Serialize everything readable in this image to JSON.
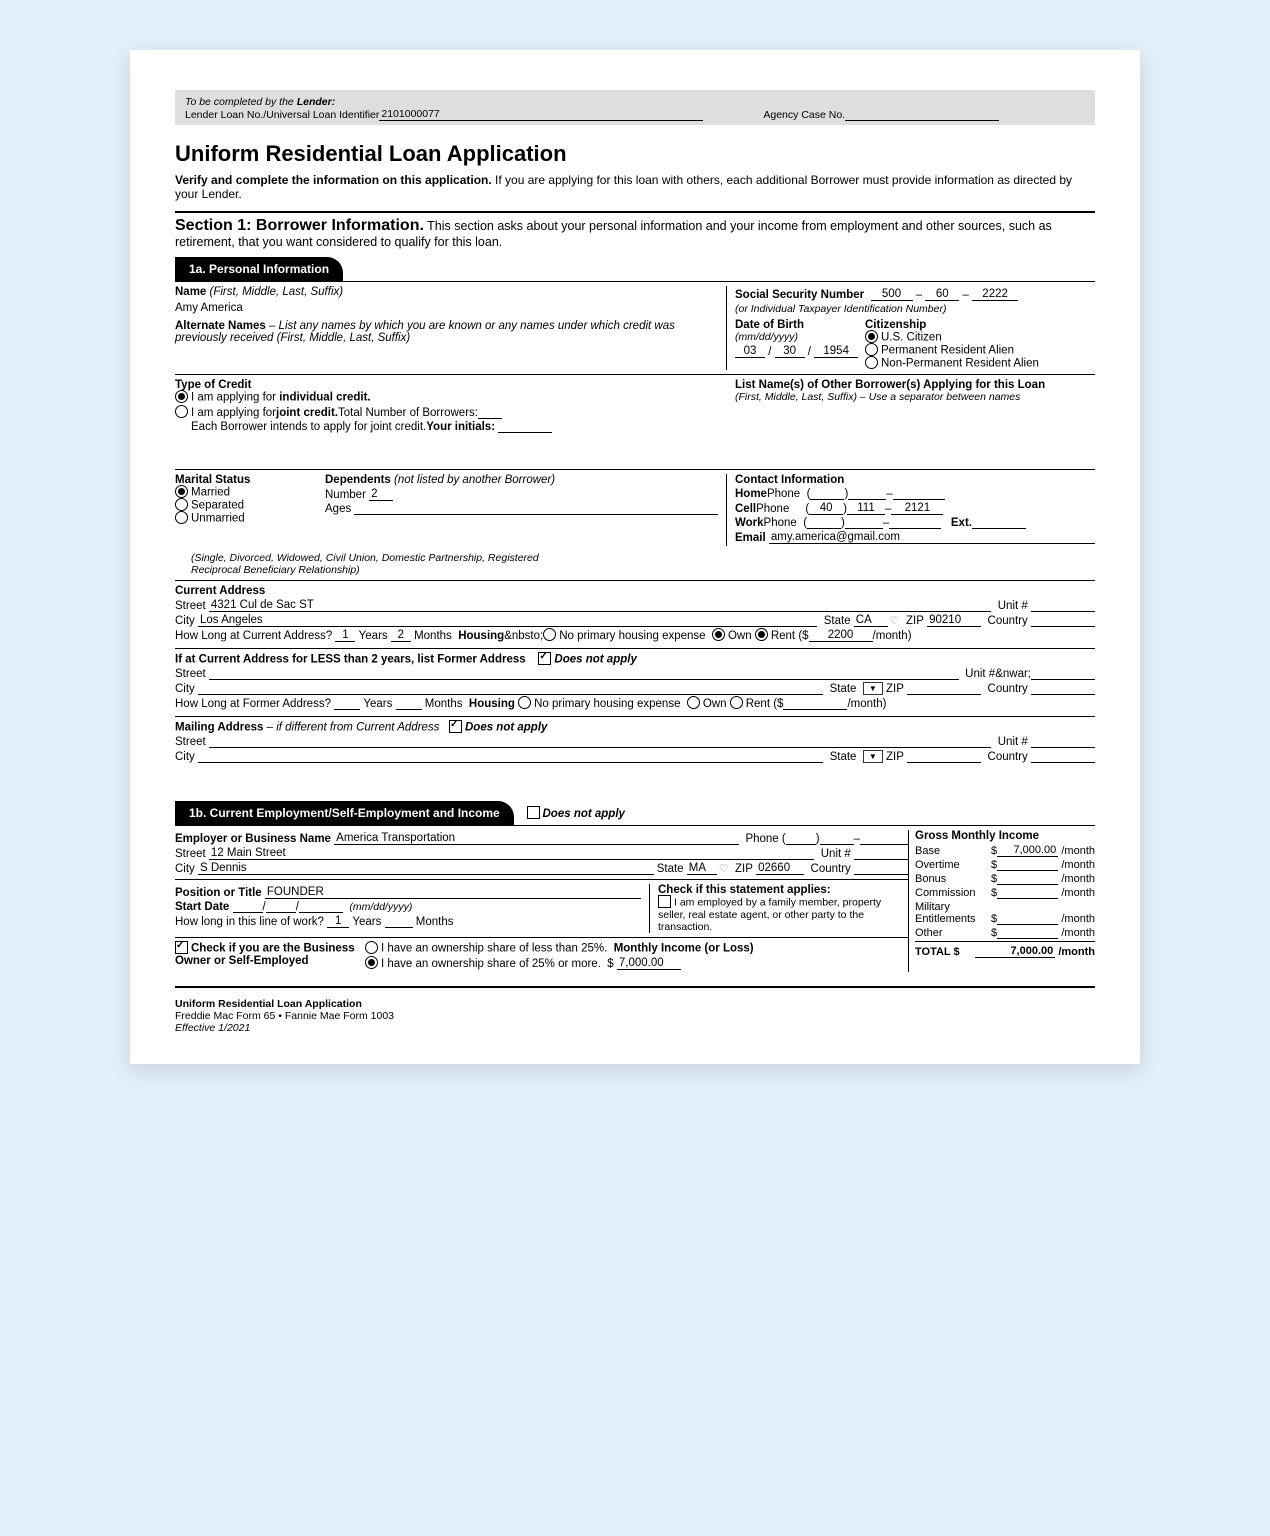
{
  "lender": {
    "top": "To be completed by the Lender:",
    "label": "Lender Loan No./Universal Loan Identifier",
    "loanNo": "2101000077",
    "agencyLabel": "Agency Case No."
  },
  "title": "Uniform Residential Loan Application",
  "intro1": "Verify and complete the information on this application.",
  "intro2": " If you are applying for this loan with others, each additional Borrower must provide information as directed by your Lender.",
  "sec1": {
    "title": "Section 1: Borrower Information.",
    "desc": " This section asks about your personal information and your income from employment and other sources, such as retirement, that you want considered to qualify for this loan."
  },
  "tab1a": "1a. Personal Information",
  "pi": {
    "nameLabel": "Name",
    "nameHint": " (First, Middle, Last, Suffix)",
    "name": "Amy America",
    "altLabel": "Alternate Names",
    "altHint": " – List any names by which you are known or any names under which credit was previously received  (First, Middle, Last, Suffix)",
    "ssnLabel": "Social Security Number",
    "ssn1": "500",
    "ssn2": "60",
    "ssn3": "2222",
    "ssnHint": "(or Individual Taxpayer Identification Number)",
    "dobLabel": "Date of Birth",
    "dobHint": "(mm/dd/yyyy)",
    "dobM": "03",
    "dobD": "30",
    "dobY": "1954",
    "citLabel": "Citizenship",
    "cit1": "U.S. Citizen",
    "cit2": "Permanent Resident Alien",
    "cit3": "Non-Permanent Resident Alien"
  },
  "credit": {
    "label": "Type of Credit",
    "opt1a": "I am applying for ",
    "opt1b": "individual credit.",
    "opt2a": "I am applying for ",
    "opt2b": "joint credit.",
    "opt2c": " Total Number of Borrowers:",
    "line3a": "Each Borrower intends to apply for joint credit. ",
    "line3b": "Your initials:",
    "otherLabel": "List Name(s) of Other Borrower(s) Applying for this Loan",
    "otherHint": "(First, Middle, Last, Suffix) – Use a separator between names"
  },
  "ms": {
    "label": "Marital Status",
    "o1": "Married",
    "o2": "Separated",
    "o3": "Unmarried",
    "fine": "(Single, Divorced, Widowed, Civil Union, Domestic Partnership, Registered Reciprocal Beneficiary Relationship)",
    "depLabel": "Dependents",
    "depHint": " (not listed by another Borrower)",
    "numLabel": "Number",
    "num": "2",
    "agesLabel": "Ages"
  },
  "contact": {
    "label": "Contact Information",
    "home": "Home",
    "cell": "Cell",
    "work": "Work",
    "phone": " Phone",
    "ext": "Ext.",
    "cellA": "40",
    "cellB": "111",
    "cellC": "2121",
    "emailLabel": "Email",
    "email": "amy.america@gmail.com"
  },
  "addr": {
    "curLabel": "Current Address",
    "street": "Street",
    "unit": "Unit #",
    "city": "City",
    "state": "State",
    "zip": "ZIP",
    "country": "Country",
    "curStreet": "4321 Cul de Sac ST",
    "curCity": "Los Angeles",
    "curState": "CA",
    "curZip": "90210",
    "howLongCur": "How Long at Current Address?",
    "y": "1",
    "m": "2",
    "years": "Years",
    "months": "Months",
    "housing": "Housing",
    "hOpt1": "No primary housing expense",
    "hOpt2": "Own",
    "hOpt3": "Rent ($",
    "rent": "2200",
    "perMonth": "/month)",
    "formerLabel": "If at Current Address for LESS than 2 years, list Former Address",
    "dna": "Does not apply",
    "howLongFormer": "How Long at Former Address?",
    "mailLabel": "Mailing Address",
    "mailHint": " – if different from Current Address"
  },
  "tab1b": "1b. Current Employment/Self-Employment and Income",
  "emp": {
    "dna": "Does not apply",
    "bizLabel": "Employer or Business Name",
    "biz": "America Transportation",
    "phone": "Phone",
    "street": "12 Main Street",
    "city": "S Dennis",
    "state": "MA",
    "zip": "02660",
    "posLabel": "Position or Title",
    "pos": "FOUNDER",
    "startLabel": "Start Date",
    "startHint": "(mm/dd/yyyy)",
    "howLong": "How long in this line of work?",
    "y": "1",
    "checkStmt": "Check if this statement applies:",
    "stmt": "I am employed by a family member, property seller, real estate agent, or other party to the transaction.",
    "ownerChk": "Check if you are the Business Owner or Self-Employed",
    "share1": "I have an ownership share of less than 25%.",
    "share2": "I have an ownership share of 25% or more.",
    "miLabel": "Monthly Income (or Loss)",
    "mi": "7,000.00"
  },
  "income": {
    "title": "Gross Monthly Income",
    "base": "Base",
    "baseV": "7,000.00",
    "ot": "Overtime",
    "bonus": "Bonus",
    "comm": "Commission",
    "mil": "Military Entitlements",
    "other": "Other",
    "total": "TOTAL $",
    "totalV": "7,000.00",
    "perMonth": "/month"
  },
  "footer": {
    "a": "Uniform Residential Loan Application",
    "b": "Freddie Mac Form 65  •  Fannie Mae Form 1003",
    "c": "Effective 1/2021"
  }
}
